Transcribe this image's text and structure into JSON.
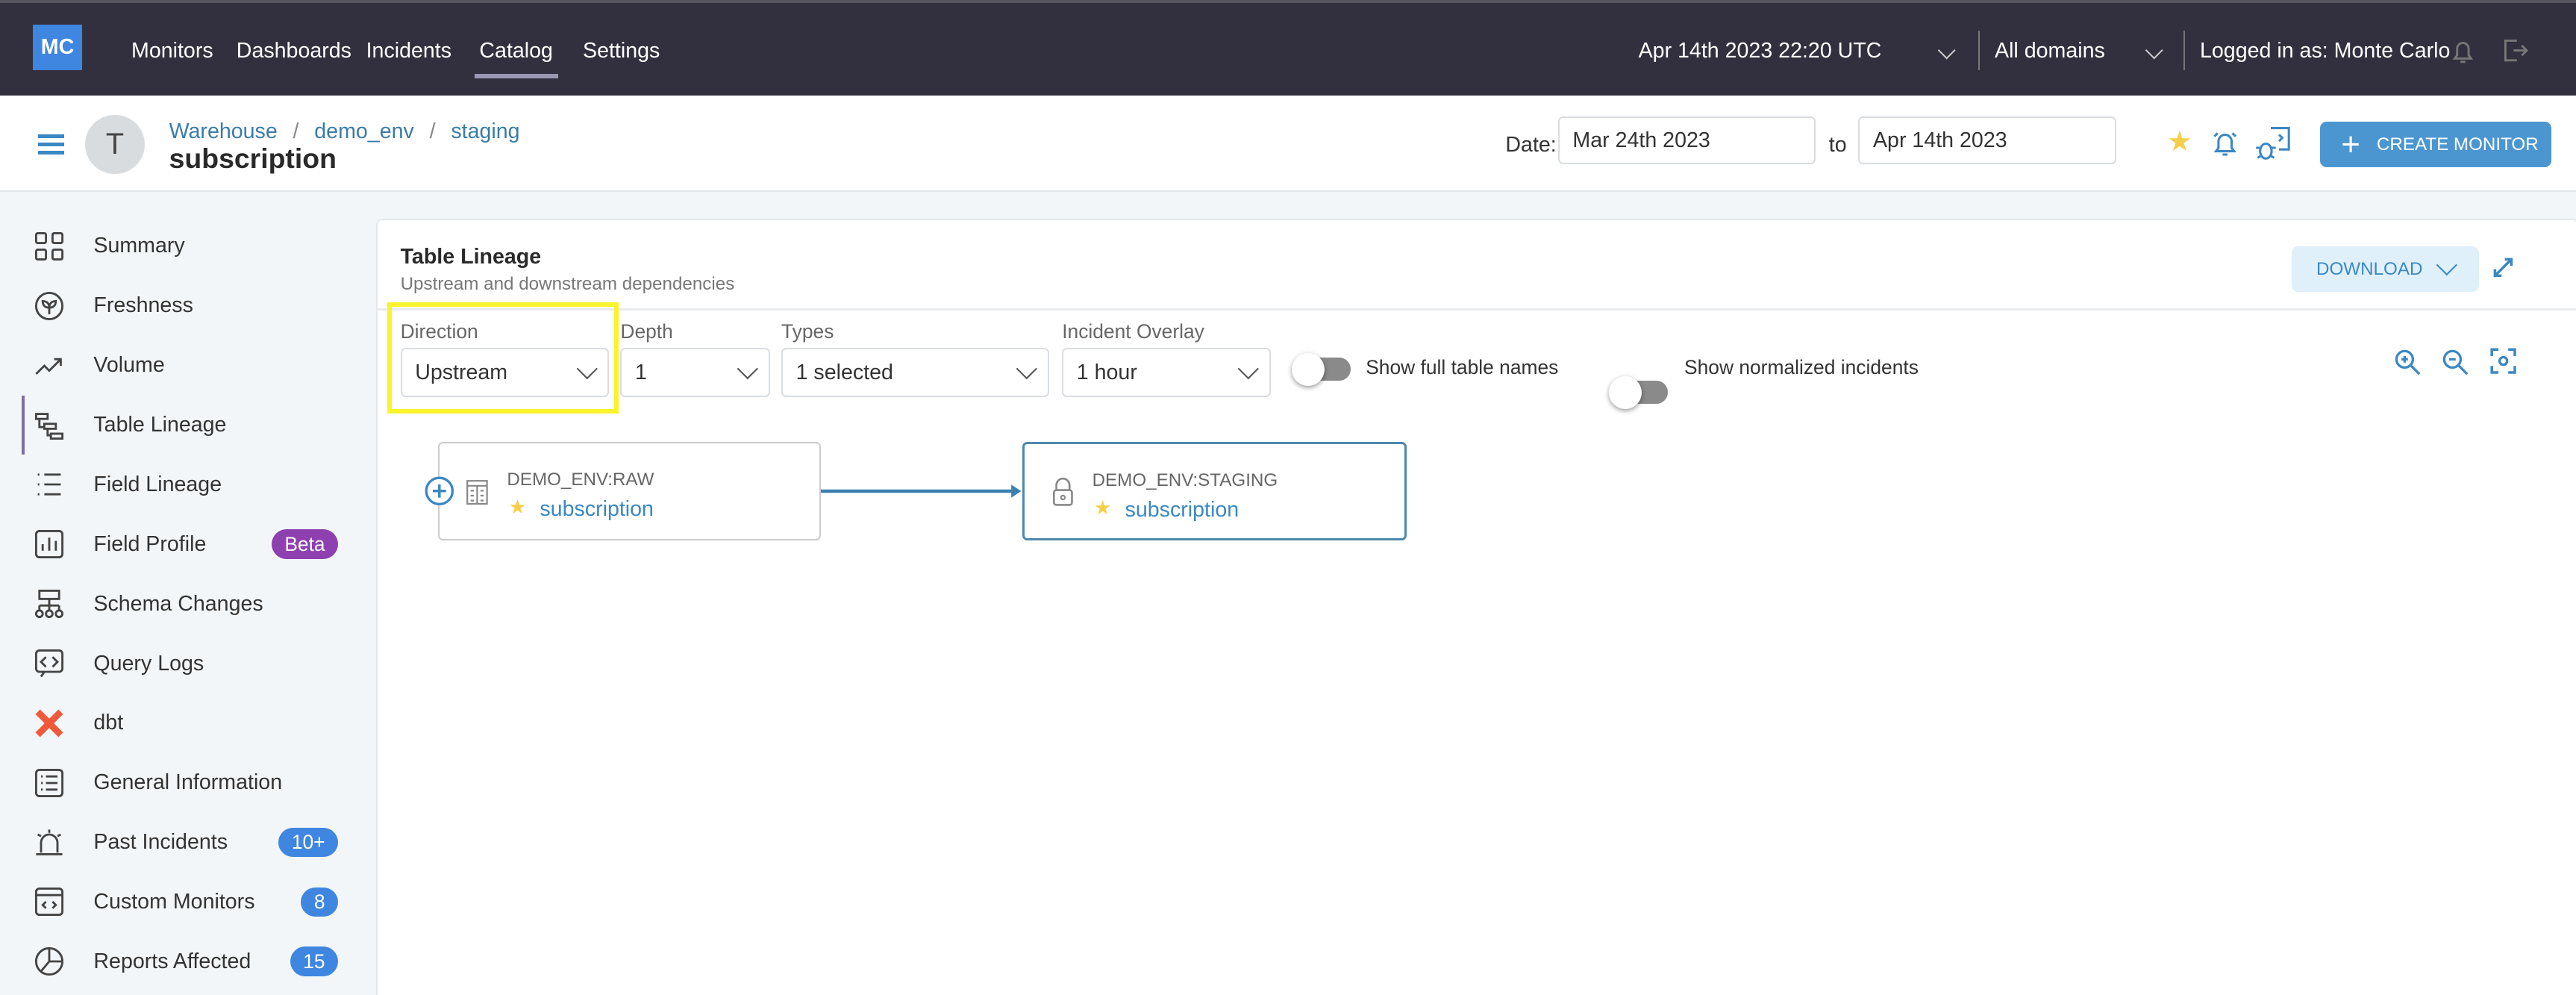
{
  "topbar": {
    "logo": "MC",
    "nav": [
      "Monitors",
      "Dashboards",
      "Incidents",
      "Catalog",
      "Settings"
    ],
    "active_nav": "Catalog",
    "datetime": "Apr 14th 2023 22:20 UTC",
    "domains": "All domains",
    "logged_in": "Logged in as: Monte Carlo"
  },
  "header": {
    "avatar": "T",
    "breadcrumb": [
      "Warehouse",
      "demo_env",
      "staging"
    ],
    "separator": "/",
    "title": "subscription",
    "date_label": "Date:",
    "date_from": "Mar 24th 2023",
    "to_label": "to",
    "date_to": "Apr 14th 2023",
    "create_monitor": "CREATE MONITOR"
  },
  "sidebar": {
    "items": [
      {
        "label": "Summary",
        "icon": "grid-icon"
      },
      {
        "label": "Freshness",
        "icon": "leaf-icon"
      },
      {
        "label": "Volume",
        "icon": "trend-icon"
      },
      {
        "label": "Table Lineage",
        "icon": "lineage-icon",
        "active": true
      },
      {
        "label": "Field Lineage",
        "icon": "list-icon"
      },
      {
        "label": "Field Profile",
        "icon": "chart-icon",
        "badge": "Beta"
      },
      {
        "label": "Schema Changes",
        "icon": "schema-icon"
      },
      {
        "label": "Query Logs",
        "icon": "code-icon"
      },
      {
        "label": "dbt",
        "icon": "dbt-icon"
      },
      {
        "label": "General Information",
        "icon": "info-list-icon"
      },
      {
        "label": "Past Incidents",
        "icon": "siren-icon",
        "badge": "10+"
      },
      {
        "label": "Custom Monitors",
        "icon": "monitor-icon",
        "badge": "8"
      },
      {
        "label": "Reports Affected",
        "icon": "pie-icon",
        "badge": "15"
      }
    ]
  },
  "lineage": {
    "title": "Table Lineage",
    "subtitle": "Upstream and downstream dependencies",
    "download": "DOWNLOAD",
    "filters": {
      "direction_label": "Direction",
      "direction": "Upstream",
      "depth_label": "Depth",
      "depth": "1",
      "types_label": "Types",
      "types": "1 selected",
      "overlay_label": "Incident Overlay",
      "overlay": "1 hour",
      "full_names": "Show full table names",
      "normalized": "Show normalized incidents"
    },
    "nodes": [
      {
        "schema": "DEMO_ENV:RAW",
        "name": "subscription"
      },
      {
        "schema": "DEMO_ENV:STAGING",
        "name": "subscription"
      }
    ]
  },
  "colors": {
    "accent": "#3a88c4",
    "topbar": "#32303f",
    "beta": "#8e3fb0",
    "highlight": "#f8f32b"
  }
}
